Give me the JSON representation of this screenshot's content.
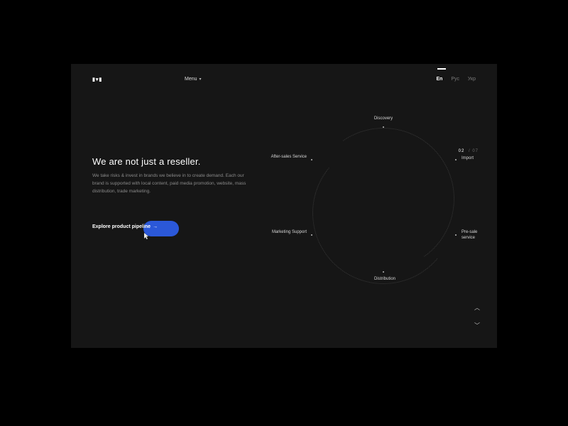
{
  "header": {
    "logo": "▮▾▮",
    "menu_label": "Menu",
    "languages": {
      "en": "En",
      "ru": "Рус",
      "uk": "Укр"
    }
  },
  "hero": {
    "heading": "We are not just a reseller.",
    "body": "We take risks & invest in brands we believe in to create demand. Each our brand is supported with local content, paid media promotion, website, mass distribution, trade marketing.",
    "cta_label": "Explore product pipeline",
    "cta_arrow": "→"
  },
  "pagination": {
    "current": "02",
    "total": "07"
  },
  "wheel": {
    "nodes": {
      "discovery": "Discovery",
      "import": "Import",
      "presale": "Pre-sale service",
      "distribution": "Distribution",
      "marketing": "Marketing Support",
      "aftersales": "After-sales Service"
    }
  },
  "scroll": {
    "up": "︿",
    "down": "﹀"
  }
}
